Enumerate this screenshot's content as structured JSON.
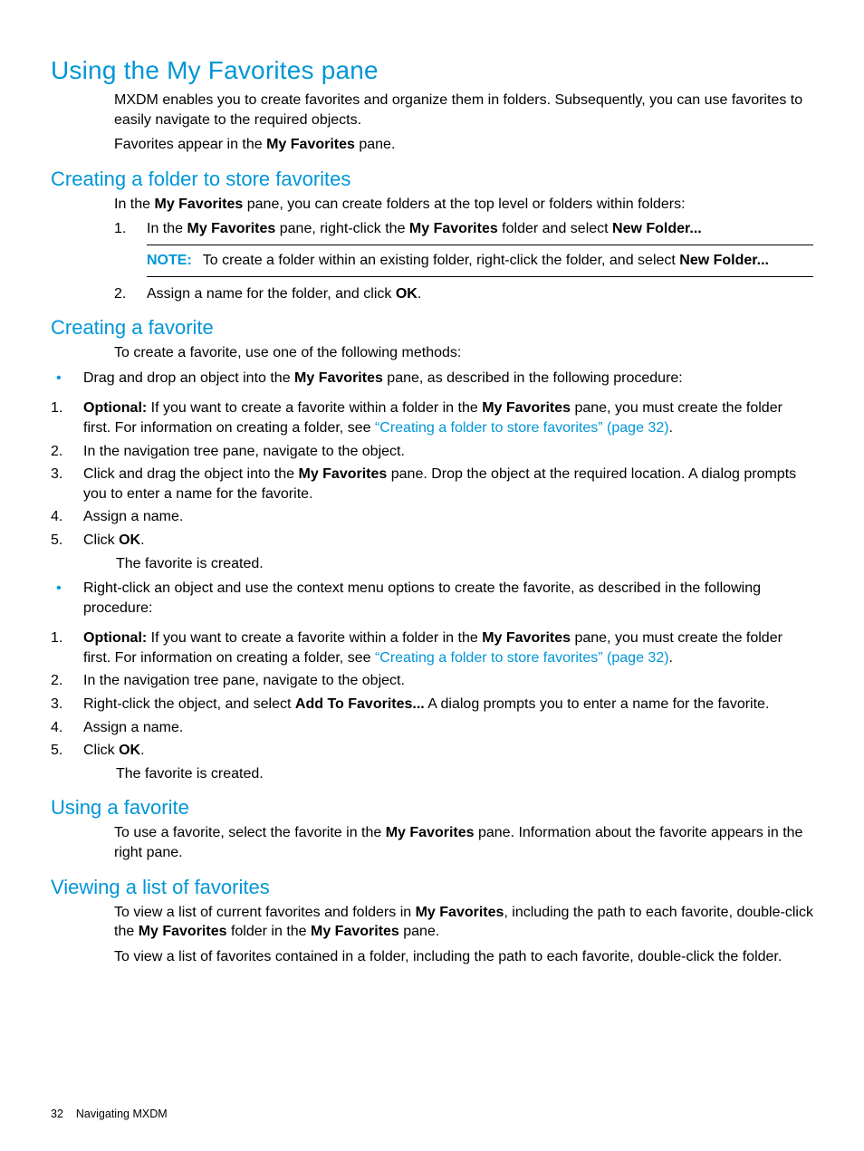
{
  "page_number": "32",
  "footer_section": "Navigating MXDM",
  "h1": "Using the My Favorites pane",
  "intro_p1_a": "MXDM enables you to create favorites and organize them in folders. Subsequently, you can use favorites to easily navigate to the required objects.",
  "intro_p2_pre": "Favorites appear in the ",
  "intro_p2_b": "My Favorites",
  "intro_p2_post": " pane.",
  "h2_1": "Creating a folder to store favorites",
  "s1_intro_pre": "In the ",
  "s1_intro_b": "My Favorites",
  "s1_intro_post": " pane, you can create folders at the top level or folders within folders:",
  "s1_li1_pre": "In the ",
  "s1_li1_b1": "My Favorites",
  "s1_li1_mid1": " pane, right-click the ",
  "s1_li1_b2": "My Favorites",
  "s1_li1_mid2": " folder and select ",
  "s1_li1_b3": "New Folder...",
  "note_label": "NOTE:",
  "note_text_pre": "To create a folder within an existing folder, right-click the folder, and select ",
  "note_text_b": "New Folder...",
  "s1_li2_pre": "Assign a name for the folder, and click ",
  "s1_li2_b": "OK",
  "s1_li2_post": ".",
  "h2_2": "Creating a favorite",
  "s2_intro": "To create a favorite, use one of the following methods:",
  "s2_b1_pre": "Drag and drop an object into the ",
  "s2_b1_b": "My Favorites",
  "s2_b1_post": " pane, as described in the following procedure:",
  "opt_b": "Optional:",
  "opt_mid1": " If you want to create a favorite within a folder in the ",
  "opt_b2": "My Favorites",
  "opt_mid2": " pane, you must create the folder first. For information on creating a folder, see ",
  "opt_link": "“Creating a folder to store favorites” (page 32)",
  "opt_post": ".",
  "nav_text": "In the navigation tree pane, navigate to the object.",
  "drag3_pre": "Click and drag the object into the ",
  "drag3_b": "My Favorites",
  "drag3_post": " pane. Drop the object at the required location. A dialog prompts you to enter a name for the favorite.",
  "assign_name": "Assign a name.",
  "click_pre": "Click ",
  "click_b": "OK",
  "click_post": ".",
  "created": "The favorite is created.",
  "s2_b2": "Right-click an object and use the context menu options to create the favorite, as described in the following procedure:",
  "rc3_pre": "Right-click the object, and select ",
  "rc3_b": "Add To Favorites...",
  "rc3_post": " A dialog prompts you to enter a name for the favorite.",
  "h2_3": "Using a favorite",
  "s3_pre": "To use a favorite, select the favorite in the ",
  "s3_b": "My Favorites",
  "s3_post": " pane. Information about the favorite appears in the right pane.",
  "h2_4": "Viewing a list of favorites",
  "s4_p1_pre": "To view a list of current favorites and folders in ",
  "s4_p1_b1": "My Favorites",
  "s4_p1_mid1": ", including the path to each favorite, double-click the ",
  "s4_p1_b2": "My Favorites",
  "s4_p1_mid2": " folder in the ",
  "s4_p1_b3": "My Favorites",
  "s4_p1_post": " pane.",
  "s4_p2": "To view a list of favorites contained in a folder, including the path to each favorite, double-click the folder."
}
